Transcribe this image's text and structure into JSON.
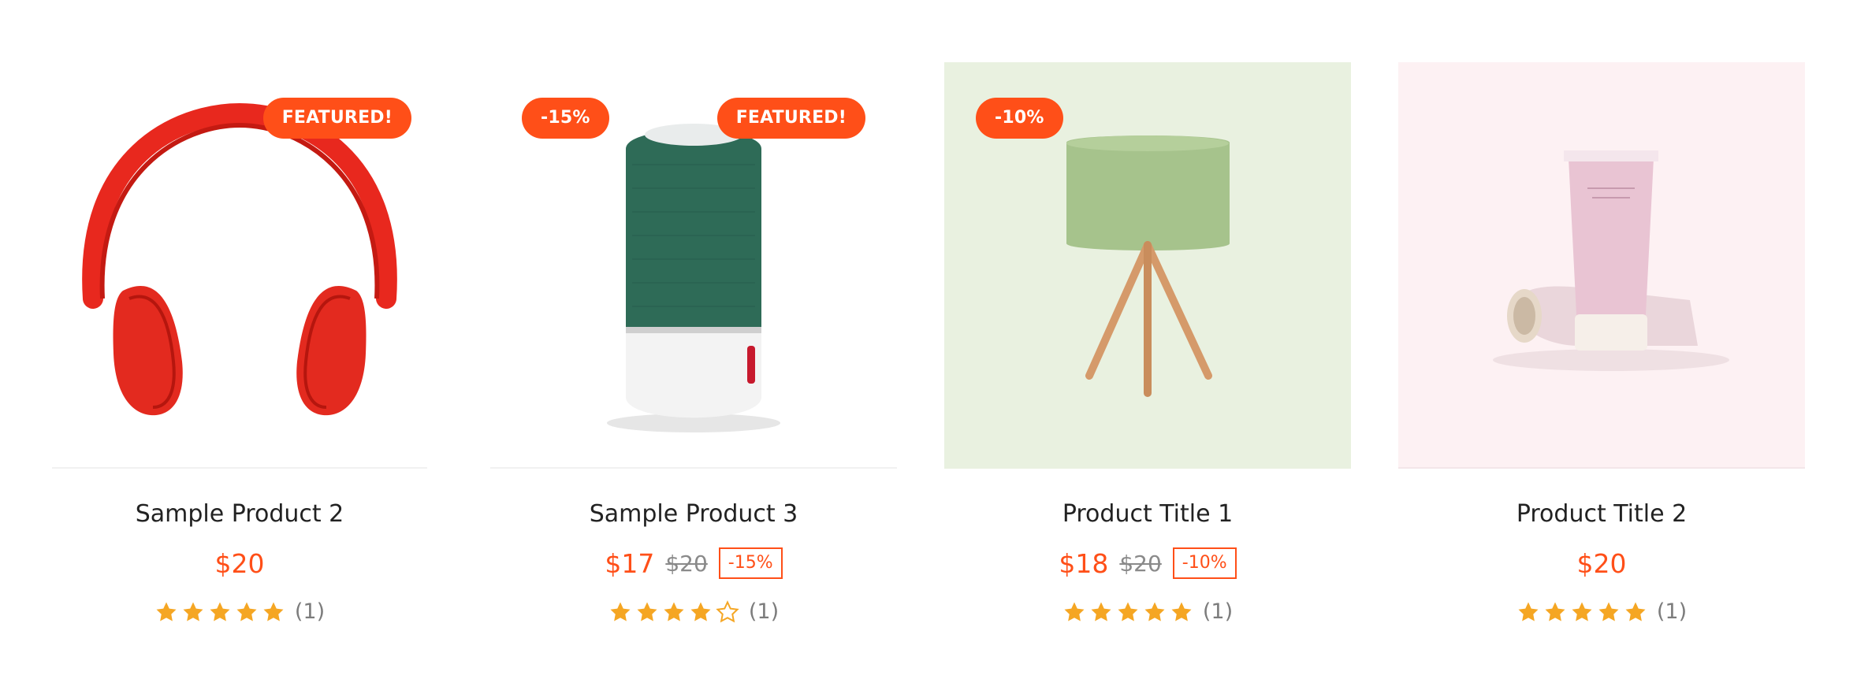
{
  "products": [
    {
      "title": "Sample Product 2",
      "badge_featured": "FEATURED!",
      "badge_discount": "",
      "price": "$20",
      "old_price": "",
      "discount_tag": "",
      "rating": 5,
      "reviews": "(1)",
      "image": "red-headphones",
      "bg": "#ffffff"
    },
    {
      "title": "Sample Product 3",
      "badge_featured": "FEATURED!",
      "badge_discount": "-15%",
      "price": "$17",
      "old_price": "$20",
      "discount_tag": "-15%",
      "rating": 4,
      "reviews": "(1)",
      "image": "green-speaker",
      "bg": "#ffffff"
    },
    {
      "title": "Product Title 1",
      "badge_featured": "",
      "badge_discount": "-10%",
      "price": "$18",
      "old_price": "$20",
      "discount_tag": "-10%",
      "rating": 5,
      "reviews": "(1)",
      "image": "green-tripod-lamp",
      "bg": "#e9f1e0"
    },
    {
      "title": "Product Title 2",
      "badge_featured": "",
      "badge_discount": "",
      "price": "$20",
      "old_price": "",
      "discount_tag": "",
      "rating": 5,
      "reviews": "(1)",
      "image": "pink-cosmetic-tubes",
      "bg": "#fdf1f3"
    }
  ],
  "colors": {
    "accent": "#ff4f18",
    "star": "#f5a623",
    "text": "#222222",
    "muted": "#8a8a8a"
  }
}
